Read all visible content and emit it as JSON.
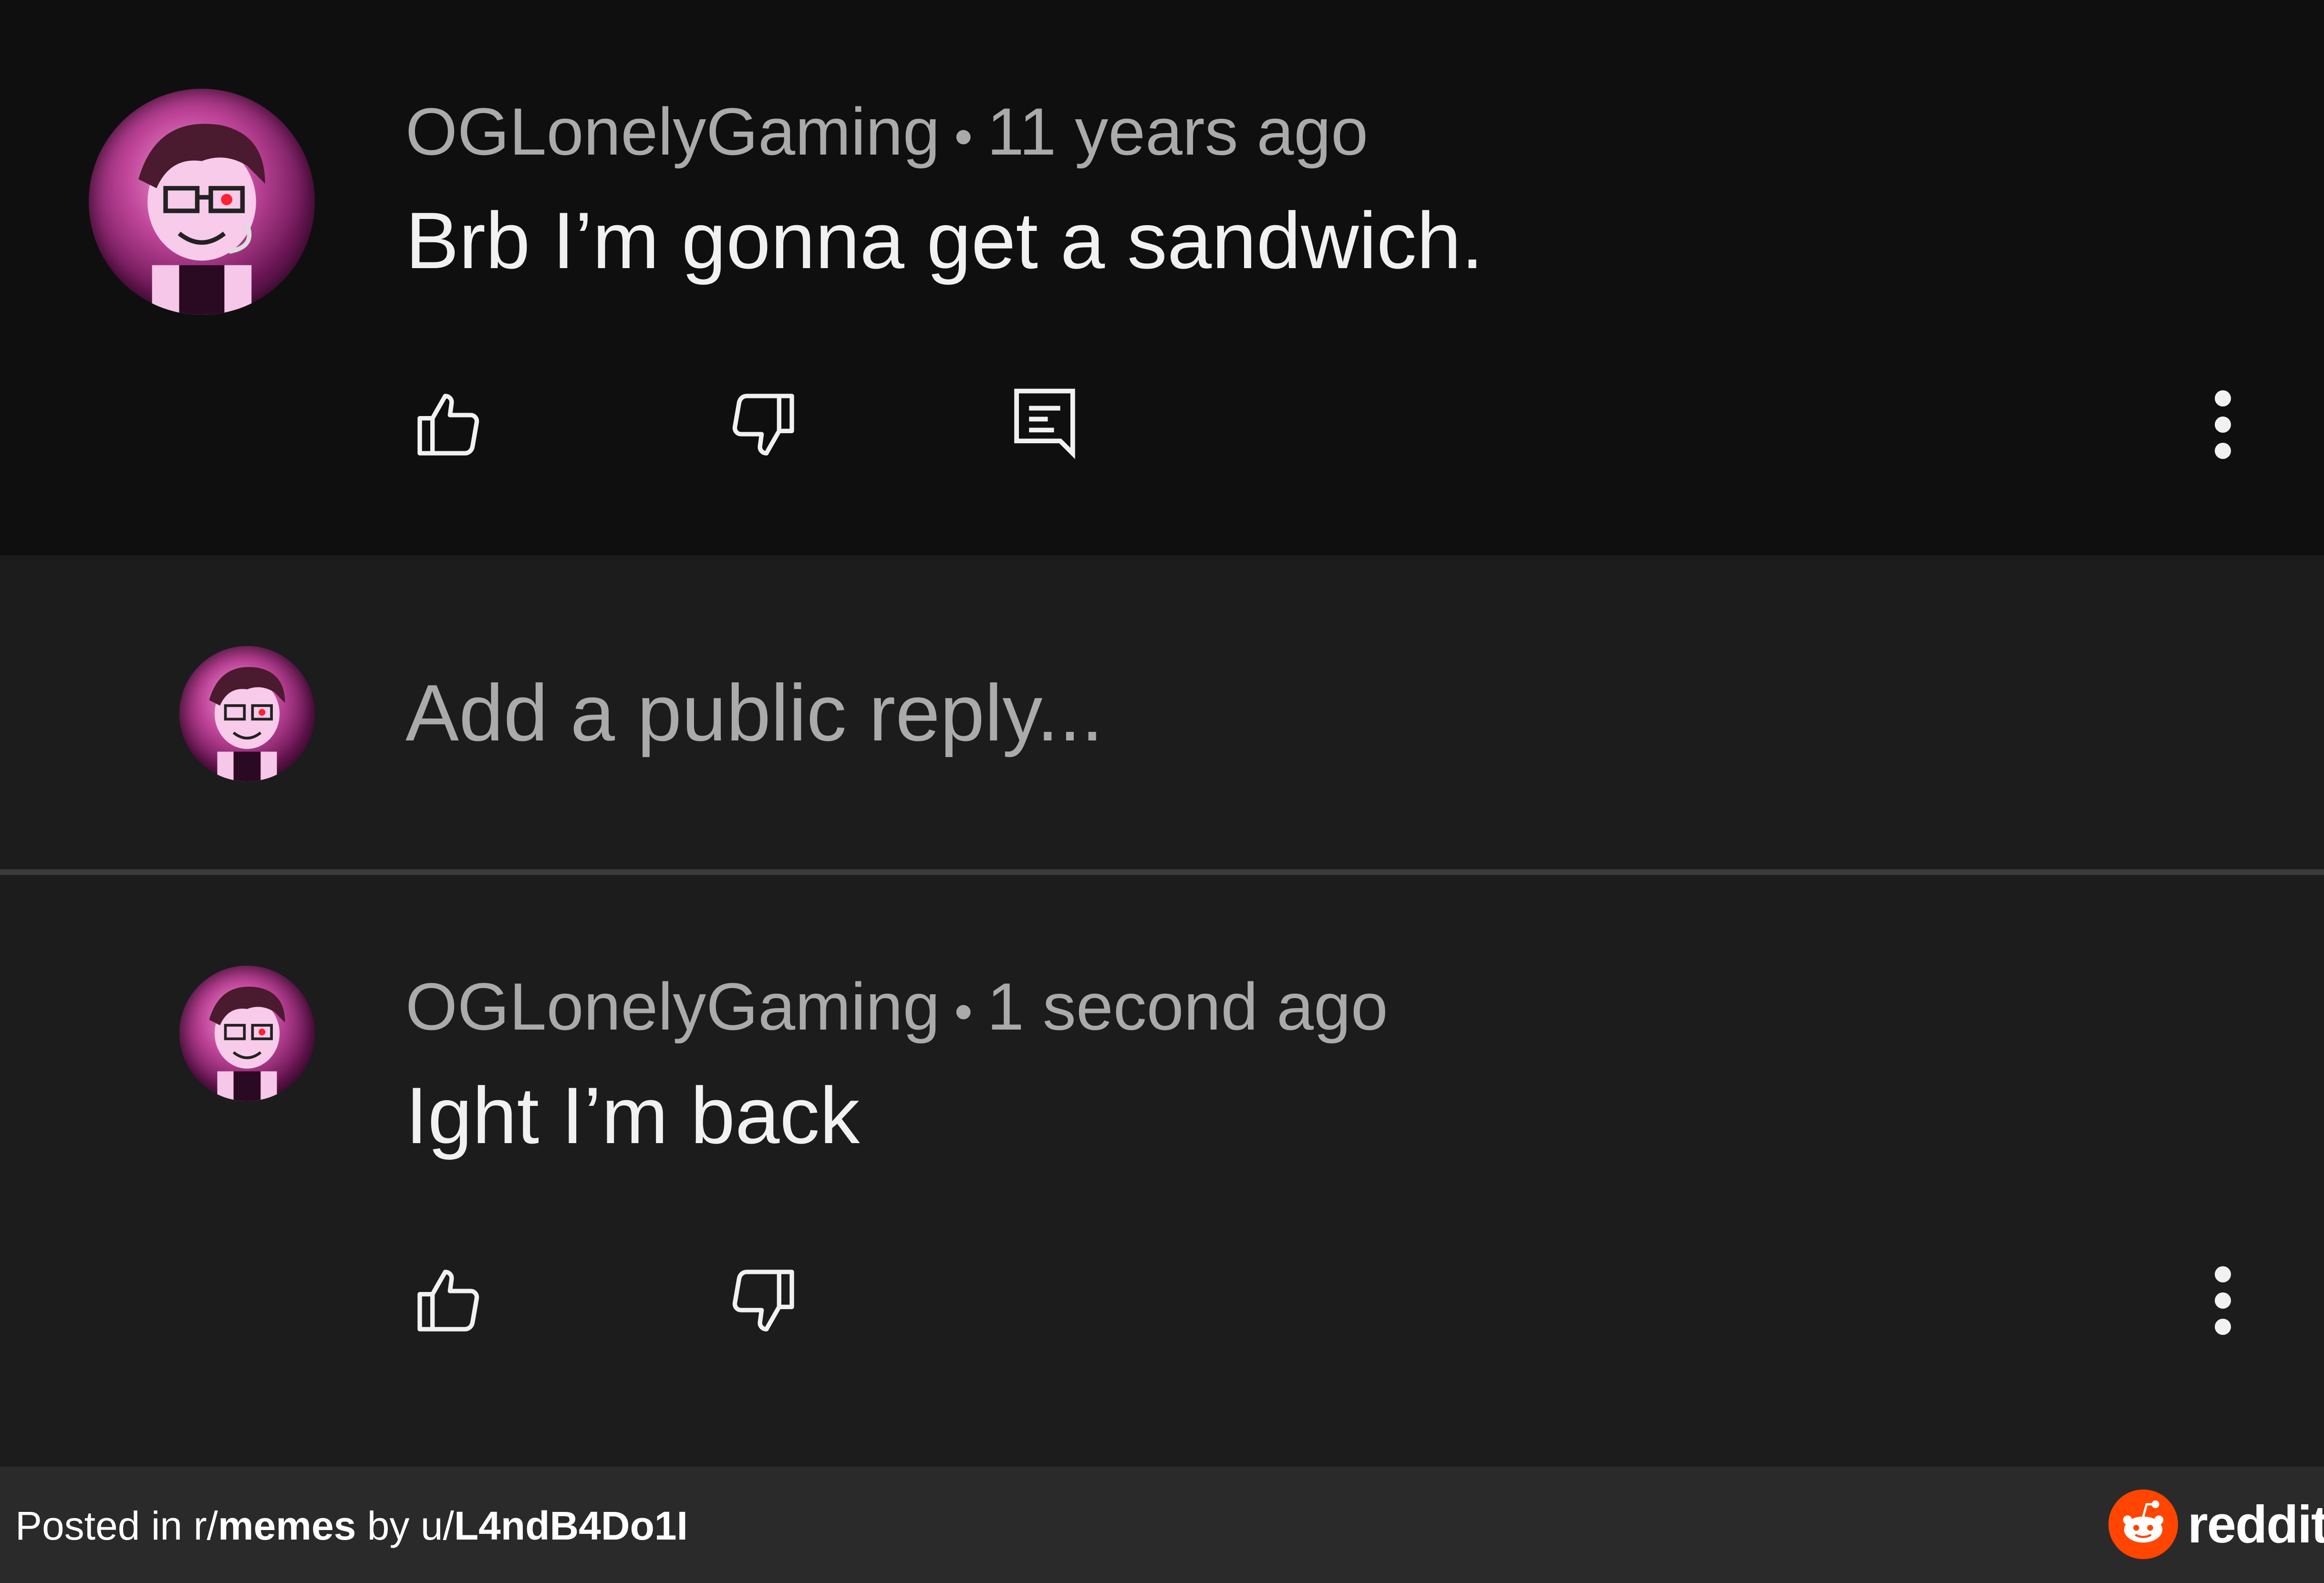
{
  "comment1": {
    "author": "OGLonelyGaming",
    "separator": "•",
    "time": "11 years ago",
    "text": "Brb I’m gonna get a sandwich."
  },
  "reply_box": {
    "placeholder": "Add a public reply..."
  },
  "comment2": {
    "author": "OGLonelyGaming",
    "separator": "•",
    "time": "1 second ago",
    "text": "Ight I’m back"
  },
  "footer": {
    "posted_in_prefix": "Posted in r/",
    "subreddit": "memes",
    "by_prefix": " by u/",
    "username": "L4ndB4Do1I",
    "brand": "reddit"
  },
  "icons": {
    "like": "thumbs-up-icon",
    "dislike": "thumbs-down-icon",
    "reply": "reply-comment-icon",
    "more": "more-vertical-icon",
    "brand": "reddit-logo-icon"
  },
  "colors": {
    "background_top": "#0f0f0f",
    "background_reply": "#1c1c1c",
    "footer_bg": "#2a2a2b",
    "reddit_orange": "#ff4500"
  }
}
